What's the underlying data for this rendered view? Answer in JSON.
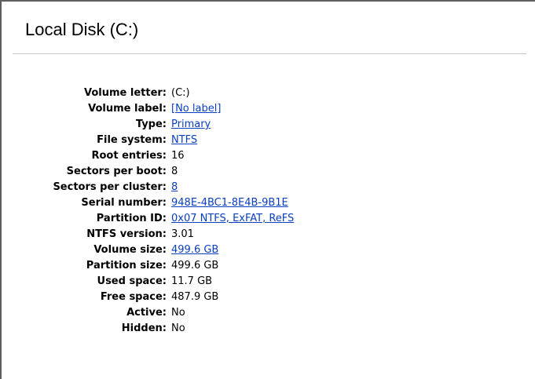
{
  "panel": {
    "title": "Local Disk (C:)"
  },
  "properties": [
    {
      "label": "Volume letter:",
      "value": "(C:)",
      "link": false
    },
    {
      "label": "Volume label:",
      "value": "[No label]",
      "link": true
    },
    {
      "label": "Type:",
      "value": "Primary",
      "link": true
    },
    {
      "label": "File system:",
      "value": "NTFS",
      "link": true
    },
    {
      "label": "Root entries:",
      "value": "16",
      "link": false
    },
    {
      "label": "Sectors per boot:",
      "value": "8",
      "link": false
    },
    {
      "label": "Sectors per cluster:",
      "value": "8",
      "link": true
    },
    {
      "label": "Serial number:",
      "value": "948E-4BC1-8E4B-9B1E",
      "link": true
    },
    {
      "label": "Partition ID:",
      "value": "0x07 NTFS, ExFAT, ReFS",
      "link": true
    },
    {
      "label": "NTFS version:",
      "value": "3.01",
      "link": false
    },
    {
      "label": "Volume size:",
      "value": "499.6 GB",
      "link": true
    },
    {
      "label": "Partition size:",
      "value": "499.6 GB",
      "link": false
    },
    {
      "label": "Used space:",
      "value": "11.7 GB",
      "link": false
    },
    {
      "label": "Free space:",
      "value": "487.9 GB",
      "link": false
    },
    {
      "label": "Active:",
      "value": "No",
      "link": false
    },
    {
      "label": "Hidden:",
      "value": "No",
      "link": false
    }
  ],
  "colors": {
    "link": "#0a3fbf",
    "text": "#000000",
    "frame_border": "#5f5f5f",
    "rule": "#c9c9c9"
  }
}
